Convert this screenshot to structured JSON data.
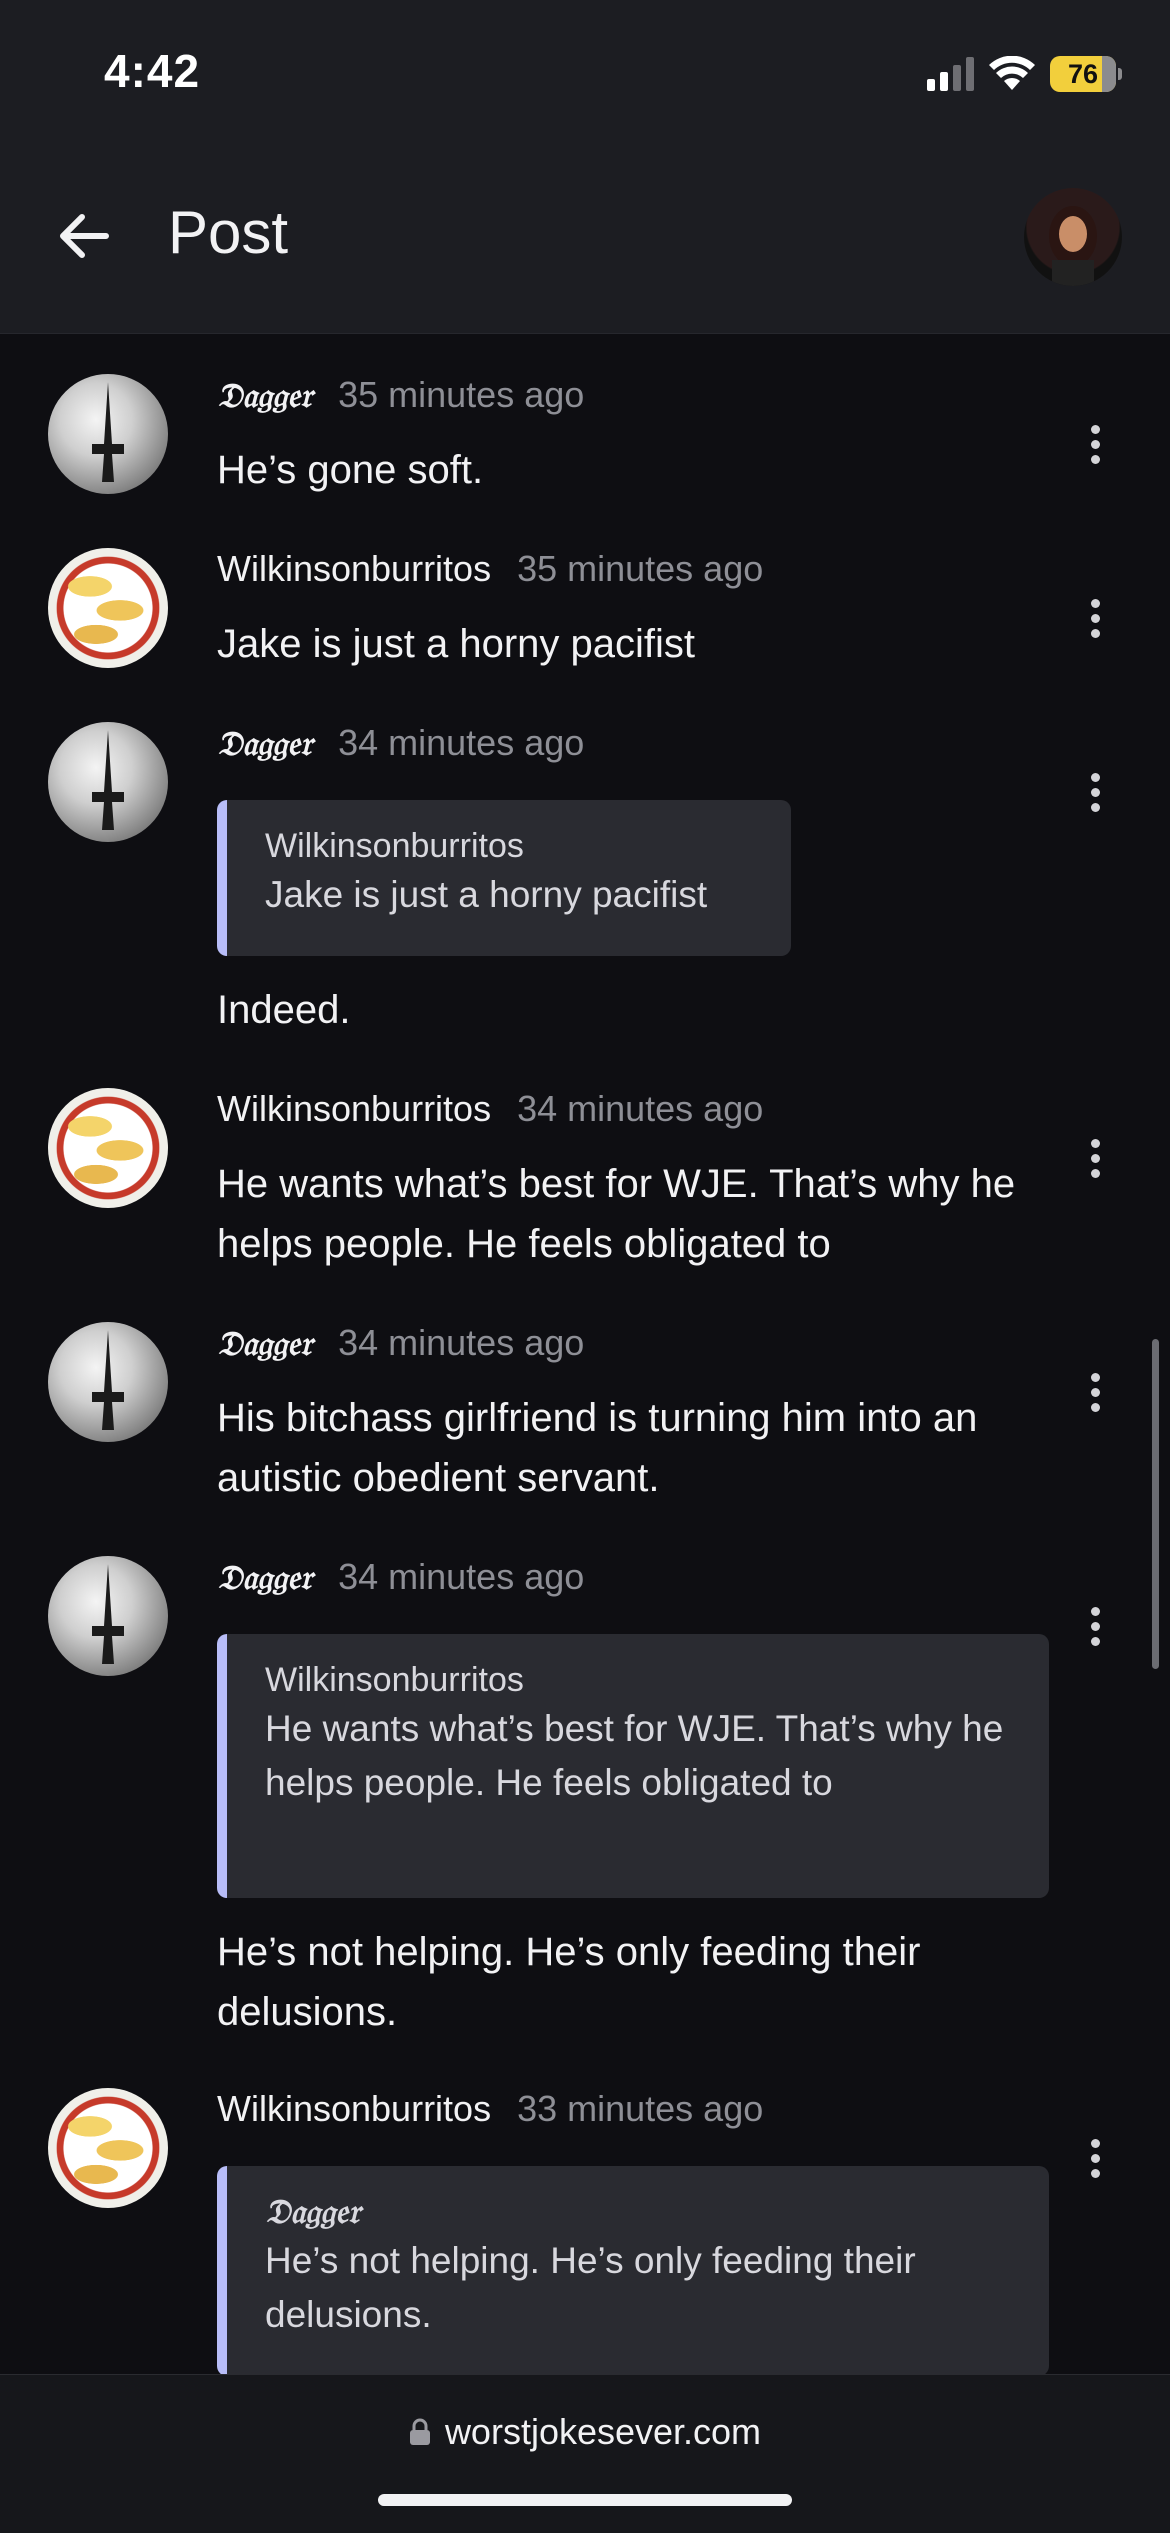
{
  "status_bar": {
    "time": "4:42",
    "battery": "76",
    "battery_level_percent": 76,
    "signal_bars": 2
  },
  "header": {
    "title": "Post"
  },
  "comments": [
    {
      "user": "𝔇𝔞𝔤𝔤𝔢𝔯",
      "ago": "35 minutes ago",
      "text": "He’s gone soft."
    },
    {
      "user": "Wilkinsonburritos",
      "ago": "35 minutes ago",
      "text": "Jake is just a horny pacifist"
    },
    {
      "user": "𝔇𝔞𝔤𝔤𝔢𝔯",
      "ago": "34 minutes ago",
      "quote": {
        "user": "Wilkinsonburritos",
        "text": "Jake is just a horny pacifist"
      },
      "text": "Indeed."
    },
    {
      "user": "Wilkinsonburritos",
      "ago": "34 minutes ago",
      "text": "He wants what’s best for WJE. That’s why he helps people. He feels obligated to"
    },
    {
      "user": "𝔇𝔞𝔤𝔤𝔢𝔯",
      "ago": "34 minutes ago",
      "text": "His bitchass girlfriend is turning him into an autistic obedient servant."
    },
    {
      "user": "𝔇𝔞𝔤𝔤𝔢𝔯",
      "ago": "34 minutes ago",
      "quote": {
        "user": "Wilkinsonburritos",
        "text": "He wants what’s best for WJE. That’s why he helps people. He feels obligated to"
      },
      "text": "He’s not helping. He’s only feeding their delusions."
    },
    {
      "user": "Wilkinsonburritos",
      "ago": "33 minutes ago",
      "quote": {
        "user": "𝔇𝔞𝔤𝔤𝔢𝔯",
        "text": "He’s not helping. He’s only feeding their delusions."
      }
    }
  ],
  "url_bar": {
    "domain": "worstjokesever.com"
  },
  "colors": {
    "background": "#0e0e12",
    "header": "#1c1d22",
    "quote_border": "#b8bdf8",
    "battery": "#f2cf3c"
  }
}
